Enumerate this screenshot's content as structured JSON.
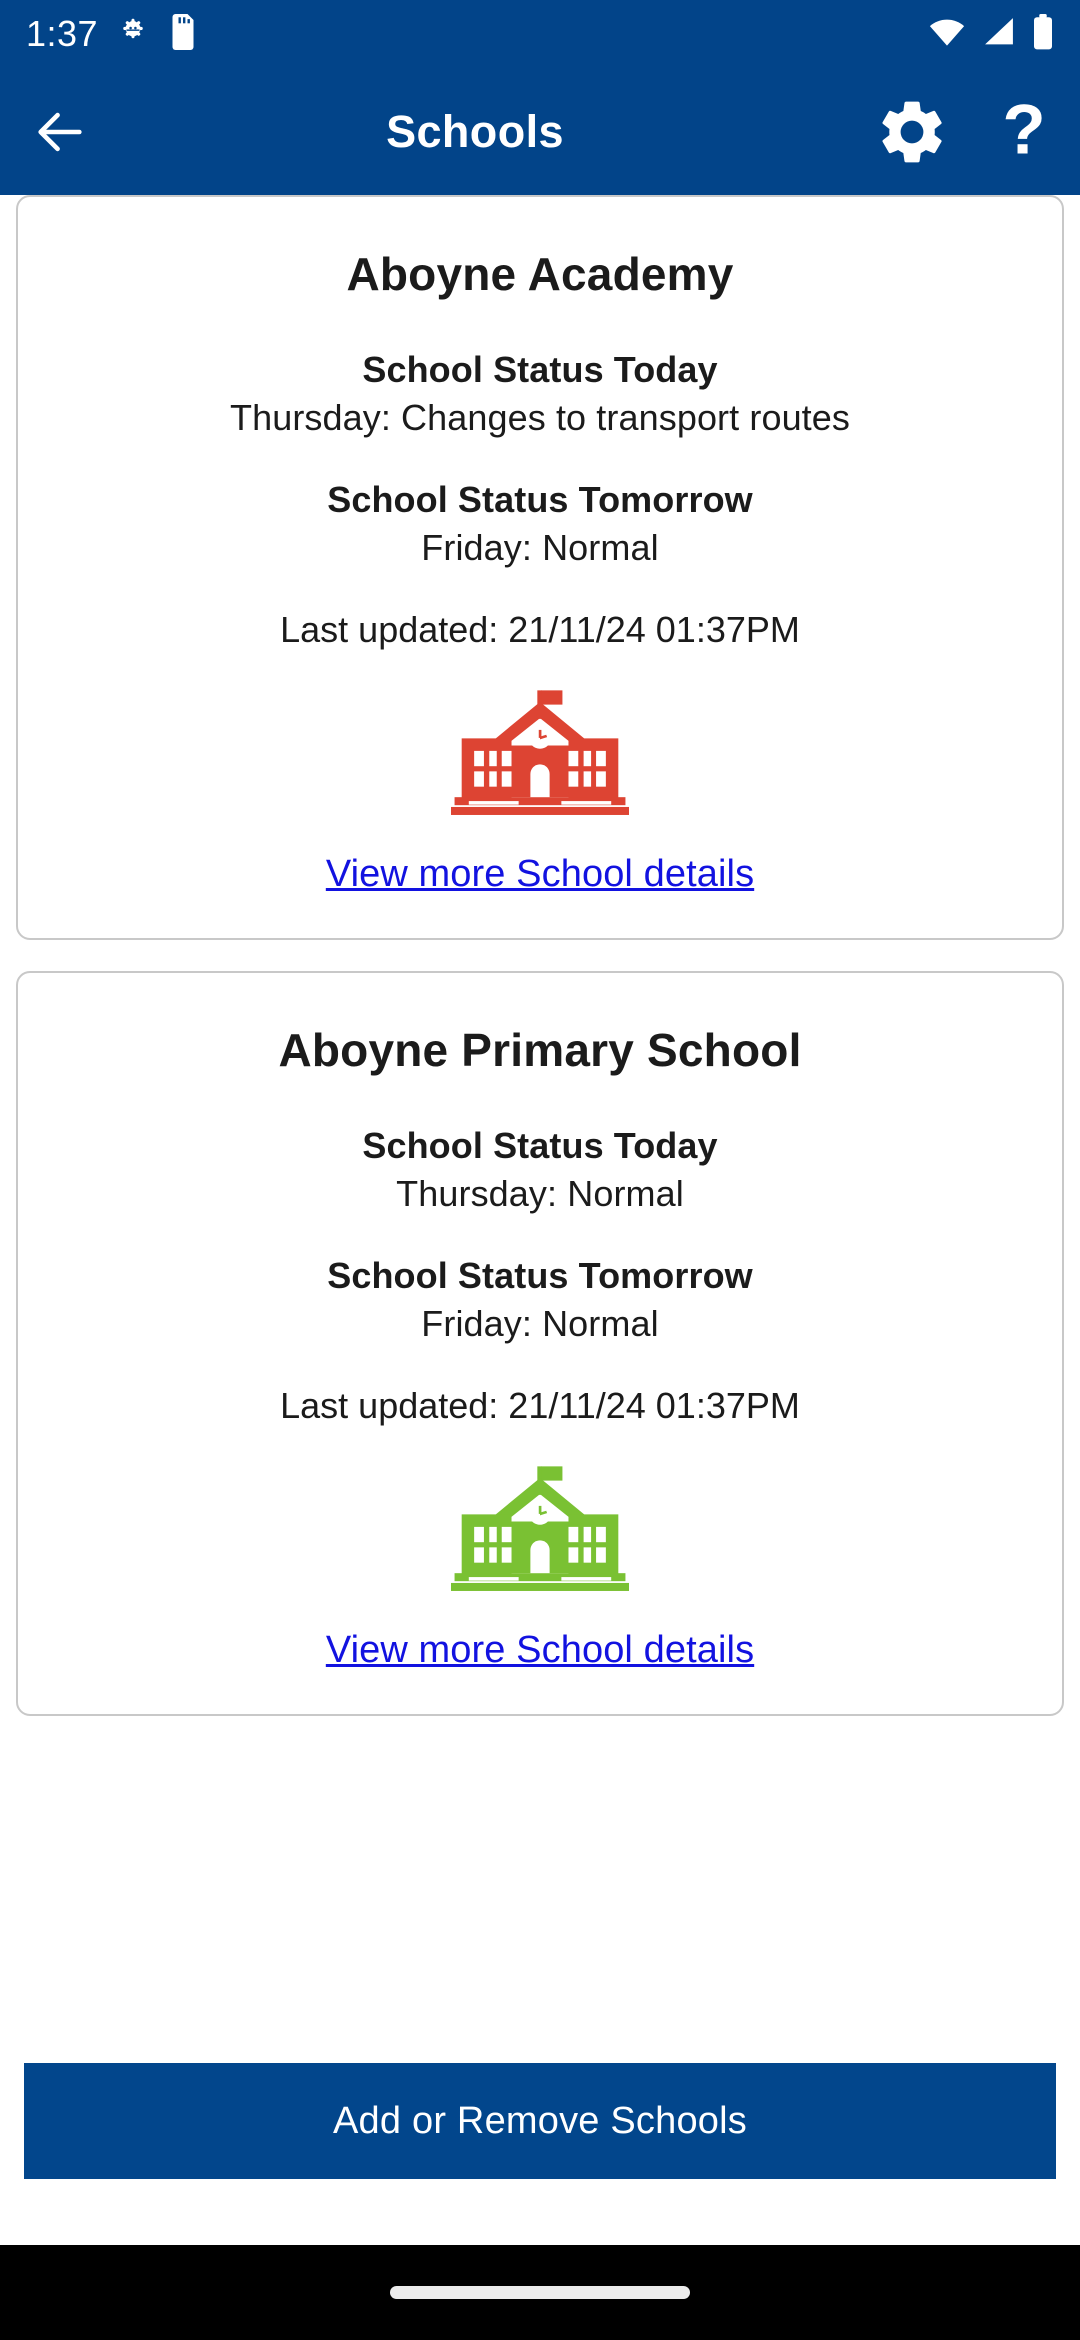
{
  "status_bar": {
    "time": "1:37",
    "icons_left": [
      "android-debug-icon",
      "sd-card-icon"
    ],
    "icons_right": [
      "wifi-icon",
      "cellular-signal-icon",
      "battery-icon"
    ],
    "background_color": "#024489"
  },
  "app_bar": {
    "back_label": "back-arrow",
    "title": "Schools",
    "settings_label": "settings",
    "help_label": "help",
    "background_color": "#024489"
  },
  "schools": [
    {
      "name": "Aboyne Academy",
      "today_heading": "School Status Today",
      "today_value": "Thursday: Changes to transport routes",
      "tomorrow_heading": "School Status Tomorrow",
      "tomorrow_value": "Friday: Normal",
      "last_updated": "Last updated: 21/11/24 01:37PM",
      "icon_name": "school-building-icon",
      "icon_color": "#dd4433",
      "link_label": "View more School details"
    },
    {
      "name": "Aboyne Primary School",
      "today_heading": "School Status Today",
      "today_value": "Thursday: Normal",
      "tomorrow_heading": "School Status Tomorrow",
      "tomorrow_value": "Friday: Normal",
      "last_updated": "Last updated: 21/11/24 01:37PM",
      "icon_name": "school-building-icon",
      "icon_color": "#7ac133",
      "link_label": "View more School details"
    }
  ],
  "footer": {
    "add_remove_label": "Add or Remove Schools",
    "button_color": "#02468c"
  },
  "nav_bar": {
    "handle_label": "home-gesture-handle",
    "background_color": "#000000"
  },
  "colors": {
    "brand_blue": "#024489",
    "link_blue": "#1212e0",
    "card_border": "#c8c8c8",
    "text": "#1b1b1b"
  }
}
